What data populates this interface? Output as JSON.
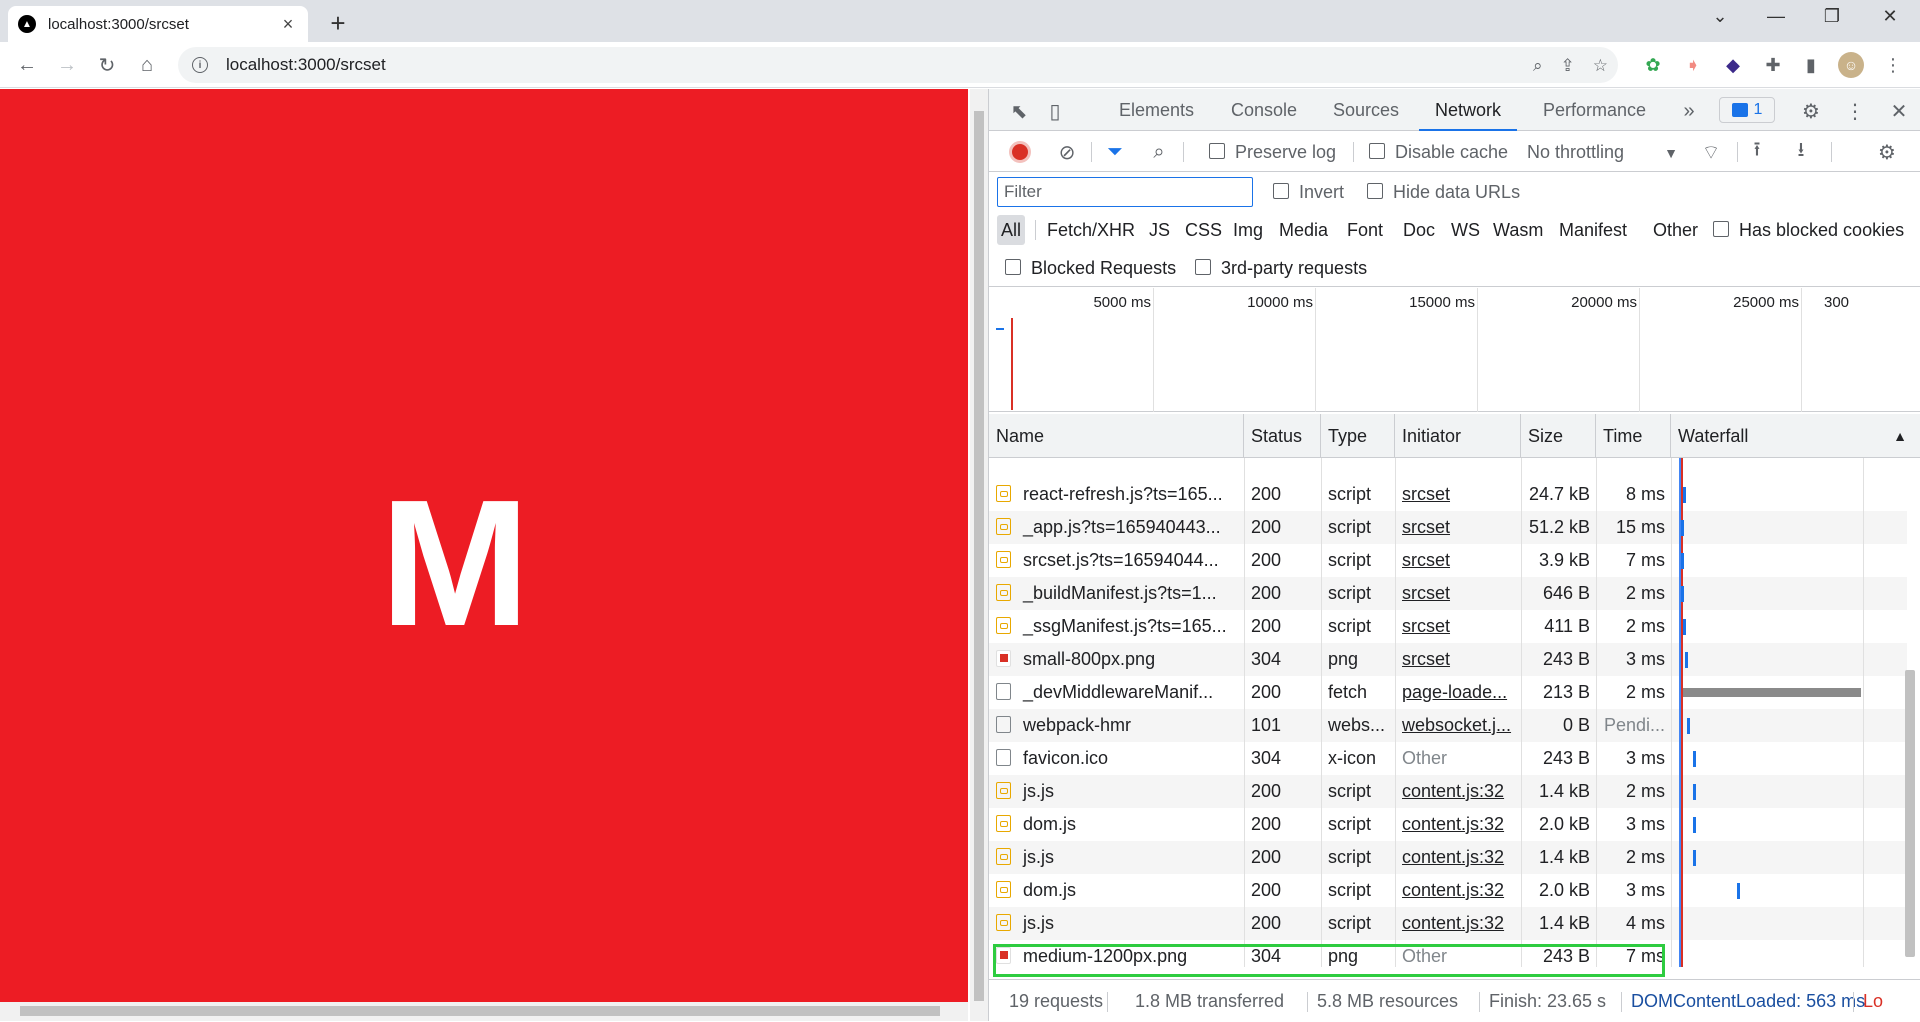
{
  "browser": {
    "tab_title": "localhost:3000/srcset",
    "url": "localhost:3000/srcset",
    "new_tab": "+"
  },
  "page": {
    "logo_letter": "M",
    "background": "#ed1c24"
  },
  "devtools": {
    "tabs": [
      "Elements",
      "Console",
      "Sources",
      "Network",
      "Performance"
    ],
    "active_tab": "Network",
    "issues_count": "1",
    "preserve_log": "Preserve log",
    "disable_cache": "Disable cache",
    "throttling": "No throttling",
    "filter_placeholder": "Filter",
    "invert": "Invert",
    "hide_data_urls": "Hide data URLs",
    "type_filters": [
      "All",
      "Fetch/XHR",
      "JS",
      "CSS",
      "Img",
      "Media",
      "Font",
      "Doc",
      "WS",
      "Wasm",
      "Manifest",
      "Other"
    ],
    "has_blocked_cookies": "Has blocked cookies",
    "blocked_requests": "Blocked Requests",
    "third_party": "3rd-party requests",
    "overview_ticks": [
      "5000 ms",
      "10000 ms",
      "15000 ms",
      "20000 ms",
      "25000 ms",
      "300"
    ],
    "columns": [
      "Name",
      "Status",
      "Type",
      "Initiator",
      "Size",
      "Time",
      "Waterfall"
    ],
    "requests": [
      {
        "name": "react-refresh.js?ts=165...",
        "status": "200",
        "type": "script",
        "initiator": "srcset",
        "size": "24.7 kB",
        "time": "8 ms",
        "icon": "script"
      },
      {
        "name": "_app.js?ts=165940443...",
        "status": "200",
        "type": "script",
        "initiator": "srcset",
        "size": "51.2 kB",
        "time": "15 ms",
        "icon": "script"
      },
      {
        "name": "srcset.js?ts=16594044...",
        "status": "200",
        "type": "script",
        "initiator": "srcset",
        "size": "3.9 kB",
        "time": "7 ms",
        "icon": "script"
      },
      {
        "name": "_buildManifest.js?ts=1...",
        "status": "200",
        "type": "script",
        "initiator": "srcset",
        "size": "646 B",
        "time": "2 ms",
        "icon": "script"
      },
      {
        "name": "_ssgManifest.js?ts=165...",
        "status": "200",
        "type": "script",
        "initiator": "srcset",
        "size": "411 B",
        "time": "2 ms",
        "icon": "script"
      },
      {
        "name": "small-800px.png",
        "status": "304",
        "type": "png",
        "initiator": "srcset",
        "size": "243 B",
        "time": "3 ms",
        "icon": "img"
      },
      {
        "name": "_devMiddlewareManif...",
        "status": "200",
        "type": "fetch",
        "initiator": "page-loade...",
        "size": "213 B",
        "time": "2 ms",
        "icon": "doc"
      },
      {
        "name": "webpack-hmr",
        "status": "101",
        "type": "webs...",
        "initiator": "websocket.j...",
        "size": "0 B",
        "time": "Pendi...",
        "icon": "doc"
      },
      {
        "name": "favicon.ico",
        "status": "304",
        "type": "x-icon",
        "initiator": "Other",
        "size": "243 B",
        "time": "3 ms",
        "icon": "doc"
      },
      {
        "name": "js.js",
        "status": "200",
        "type": "script",
        "initiator": "content.js:32",
        "size": "1.4 kB",
        "time": "2 ms",
        "icon": "script"
      },
      {
        "name": "dom.js",
        "status": "200",
        "type": "script",
        "initiator": "content.js:32",
        "size": "2.0 kB",
        "time": "3 ms",
        "icon": "script"
      },
      {
        "name": "js.js",
        "status": "200",
        "type": "script",
        "initiator": "content.js:32",
        "size": "1.4 kB",
        "time": "2 ms",
        "icon": "script"
      },
      {
        "name": "dom.js",
        "status": "200",
        "type": "script",
        "initiator": "content.js:32",
        "size": "2.0 kB",
        "time": "3 ms",
        "icon": "script"
      },
      {
        "name": "js.js",
        "status": "200",
        "type": "script",
        "initiator": "content.js:32",
        "size": "1.4 kB",
        "time": "4 ms",
        "icon": "script"
      },
      {
        "name": "medium-1200px.png",
        "status": "304",
        "type": "png",
        "initiator": "Other",
        "size": "243 B",
        "time": "7 ms",
        "icon": "img"
      }
    ],
    "status": {
      "requests": "19 requests",
      "transferred": "1.8 MB transferred",
      "resources": "5.8 MB resources",
      "finish": "Finish: 23.65 s",
      "dcl": "DOMContentLoaded: 563 ms",
      "load": "Lo"
    }
  }
}
